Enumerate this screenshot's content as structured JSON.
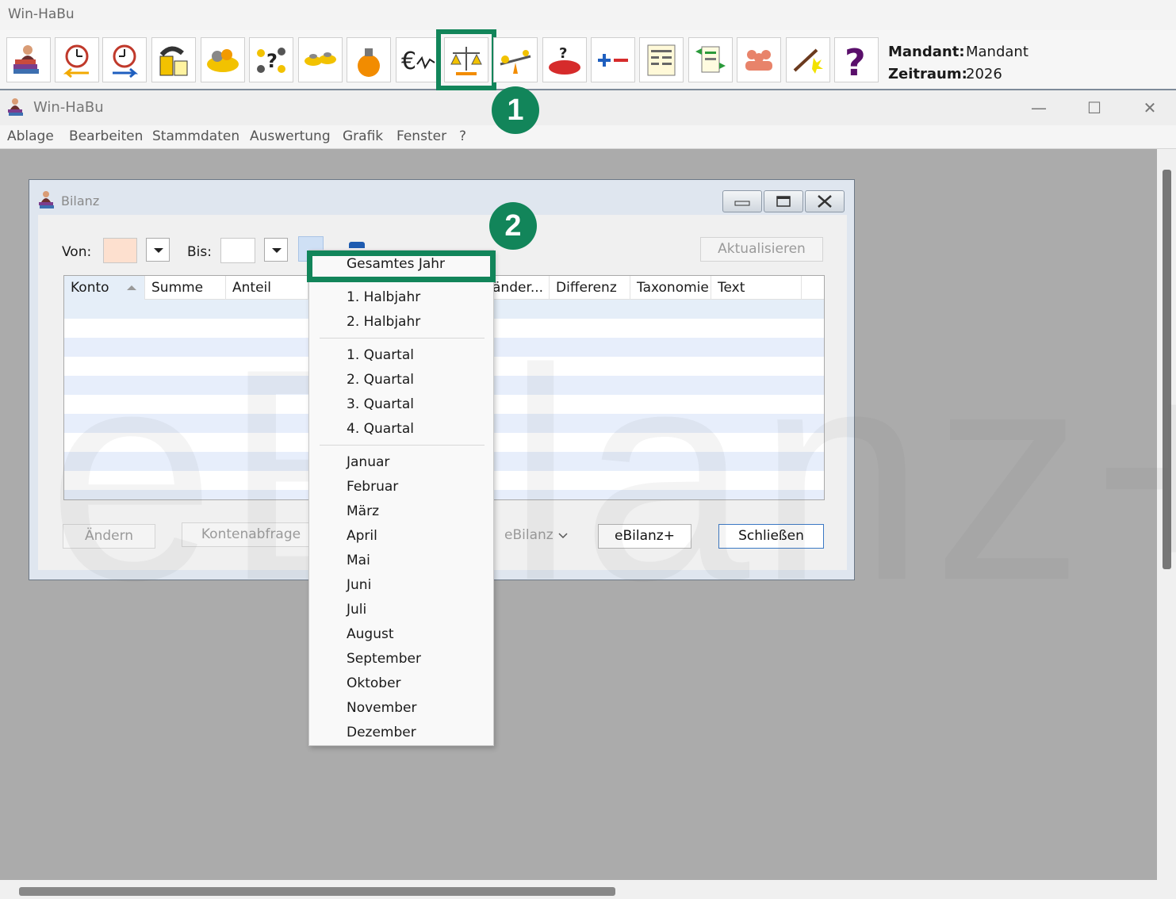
{
  "app": {
    "title": "Win-HaBu",
    "mandant_label": "Mandant:",
    "mandant_value": "Mandant",
    "zeitraum_label": "Zeitraum:",
    "zeitraum_value": "2026"
  },
  "toolbar": {
    "buttons": [
      {
        "icon": "books-person-icon"
      },
      {
        "icon": "clock-left-arrow-icon"
      },
      {
        "icon": "clock-right-arrow-icon"
      },
      {
        "icon": "boxes-icon"
      },
      {
        "icon": "coins-bowl-icon"
      },
      {
        "icon": "question-coins-icon"
      },
      {
        "icon": "coin-piles-icon"
      },
      {
        "icon": "money-bag-icon"
      },
      {
        "icon": "euro-chart-icon"
      },
      {
        "icon": "balance-scale-icon"
      },
      {
        "icon": "seesaw-icon"
      },
      {
        "icon": "pot-question-icon"
      },
      {
        "icon": "plus-minus-icon"
      },
      {
        "icon": "report-icon"
      },
      {
        "icon": "document-arrows-icon"
      },
      {
        "icon": "people-icon"
      },
      {
        "icon": "magic-wand-icon"
      },
      {
        "icon": "help-icon"
      }
    ]
  },
  "window": {
    "title": "Win-HaBu",
    "menu": [
      "Ablage",
      "Bearbeiten",
      "Stammdaten",
      "Auswertung",
      "Grafik",
      "Fenster",
      "?"
    ]
  },
  "badges": {
    "one": "1",
    "two": "2"
  },
  "dialog": {
    "title": "Bilanz",
    "von_label": "Von:",
    "bis_label": "Bis:",
    "aktualisieren": "Aktualisieren",
    "columns": [
      "Konto",
      "Summe",
      "Anteil",
      "änder...",
      "Differenz",
      "Taxonomie",
      "Text"
    ],
    "buttons": {
      "aendern": "Ändern",
      "kontenabfrage": "Kontenabfrage",
      "ebilanz": "eBilanz",
      "ebilanz_plus": "eBilanz+",
      "schliessen": "Schließen"
    },
    "watermark": "eBilanz+"
  },
  "period_menu": {
    "year": "Gesamtes Jahr",
    "halves": [
      "1. Halbjahr",
      "2. Halbjahr"
    ],
    "quarters": [
      "1. Quartal",
      "2. Quartal",
      "3. Quartal",
      "4. Quartal"
    ],
    "months": [
      "Januar",
      "Februar",
      "März",
      "April",
      "Mai",
      "Juni",
      "Juli",
      "August",
      "September",
      "Oktober",
      "November",
      "Dezember"
    ]
  },
  "colors": {
    "highlight": "#12855a",
    "row_alt": "#e7eefb",
    "von_field": "#fde0cf"
  }
}
